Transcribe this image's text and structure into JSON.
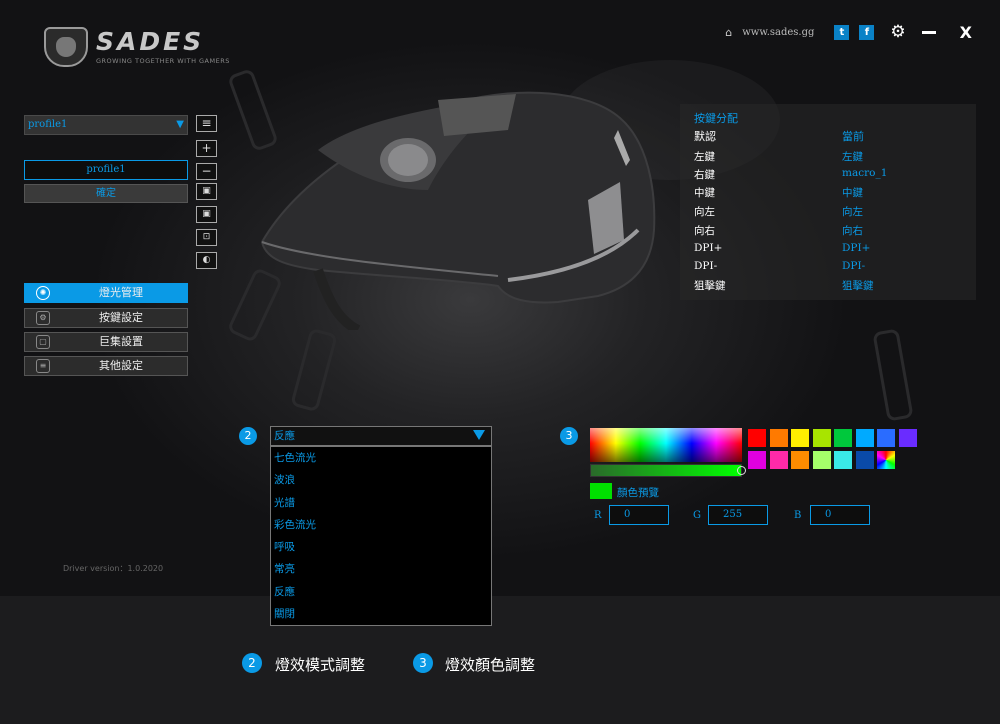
{
  "header": {
    "brand": "SADES",
    "tagline": "GROWING TOGETHER WITH GAMERS",
    "website": "www.sades.gg",
    "twitter_icon": "twitter-icon",
    "facebook_icon": "facebook-icon",
    "settings_icon": "gear-icon",
    "minimize_icon": "minimize-icon",
    "close_glyph": "X"
  },
  "profile": {
    "selected": "profile1",
    "name_value": "profile1",
    "confirm_label": "確定",
    "side_buttons": [
      "≡",
      "+",
      "−",
      "▣",
      "▣",
      "⊡",
      "◐"
    ]
  },
  "nav": {
    "items": [
      {
        "label": "燈光管理",
        "icon": "light-icon",
        "active": true
      },
      {
        "label": "按鍵設定",
        "icon": "key-settings-icon",
        "active": false
      },
      {
        "label": "巨集設置",
        "icon": "macro-icon",
        "active": false
      },
      {
        "label": "其他設定",
        "icon": "other-settings-icon",
        "active": false
      }
    ]
  },
  "key_assign": {
    "title": "按鍵分配",
    "header_default": "默認",
    "header_current": "當前",
    "rows": [
      {
        "default": "左鍵",
        "current": "左鍵"
      },
      {
        "default": "右鍵",
        "current": "macro_1"
      },
      {
        "default": "中鍵",
        "current": "中鍵"
      },
      {
        "default": "向左",
        "current": "向左"
      },
      {
        "default": "向右",
        "current": "向右"
      },
      {
        "default": "DPI+",
        "current": "DPI+"
      },
      {
        "default": "DPI-",
        "current": "DPI-"
      },
      {
        "default": "狙擊鍵",
        "current": "狙擊鍵"
      }
    ]
  },
  "effect": {
    "badge_mode": "2",
    "badge_color": "3",
    "mode_selected": "反應",
    "mode_options": [
      "七色流光",
      "波浪",
      "光譜",
      "彩色流光",
      "呼吸",
      "常亮",
      "反應",
      "關閉"
    ],
    "brightness_percent": 100,
    "preview_color": "#00e000",
    "preview_label": "顏色預覽",
    "rgb": {
      "r_label": "R",
      "r": "0",
      "g_label": "G",
      "g": "255",
      "b_label": "B",
      "b": "0"
    },
    "swatches": [
      "#ff0000",
      "#ff7a00",
      "#ffee00",
      "#a8e400",
      "#00c83c",
      "#00aaff",
      "#2a6cff",
      "#6a2cff",
      "#e000e0",
      "#ff2aa8",
      "#ff8c00",
      "#a6ff6a",
      "#3ae8e8",
      "#0a4aa8",
      "rainbow"
    ]
  },
  "footer": {
    "driver_version": "Driver version：1.0.2020"
  },
  "legend": {
    "items": [
      {
        "badge": "2",
        "label": "燈效模式調整"
      },
      {
        "badge": "3",
        "label": "燈效顏色調整"
      }
    ]
  }
}
